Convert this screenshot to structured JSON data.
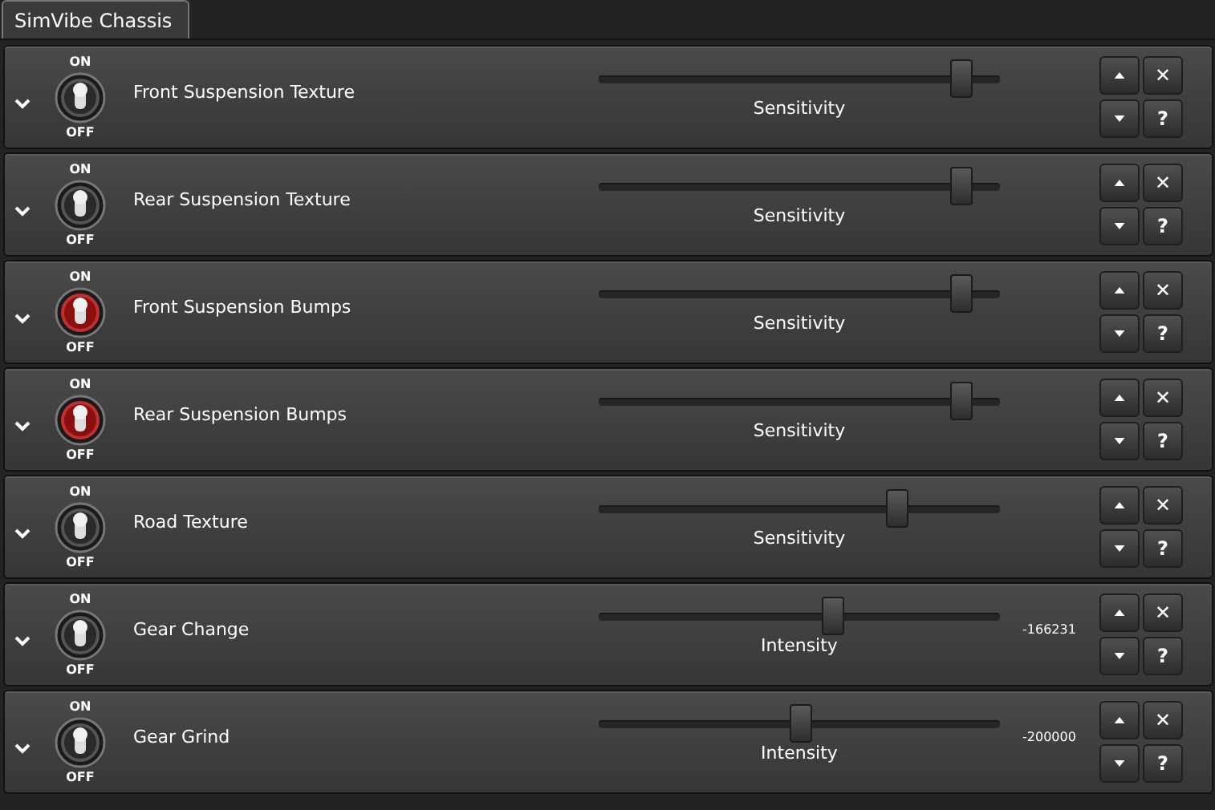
{
  "tab": {
    "label": "SimVibe Chassis",
    "selected": true
  },
  "effects": [
    {
      "name": "Front Suspension Texture",
      "on": false,
      "on_label": "ON",
      "off_label": "OFF",
      "slider_label": "Sensitivity",
      "level": 0.9,
      "close": "✕",
      "help": "?"
    },
    {
      "name": "Rear Suspension Texture",
      "on": false,
      "on_label": "ON",
      "off_label": "OFF",
      "slider_label": "Sensitivity",
      "level": 0.9,
      "close": "✕",
      "help": "?"
    },
    {
      "name": "Front Suspension Bumps",
      "on": true,
      "on_label": "ON",
      "off_label": "OFF",
      "slider_label": "Sensitivity",
      "level": 0.9,
      "close": "✕",
      "help": "?"
    },
    {
      "name": "Rear Suspension Bumps",
      "on": true,
      "on_label": "ON",
      "off_label": "OFF",
      "slider_label": "Sensitivity",
      "level": 0.9,
      "close": "✕",
      "help": "?"
    },
    {
      "name": "Road Texture",
      "on": false,
      "on_label": "ON",
      "off_label": "OFF",
      "slider_label": "Sensitivity",
      "level": 0.74,
      "close": "✕",
      "help": "?"
    },
    {
      "name": "Gear Change",
      "on": false,
      "on_label": "ON",
      "off_label": "OFF",
      "slider_label": "Intensity",
      "level": 0.58,
      "reading": "-166231",
      "close": "✕",
      "help": "?"
    },
    {
      "name": "Gear Grind",
      "on": false,
      "on_label": "ON",
      "off_label": "OFF",
      "slider_label": "Intensity",
      "level": 0.5,
      "reading": "-200000",
      "close": "✕",
      "help": "?"
    }
  ]
}
